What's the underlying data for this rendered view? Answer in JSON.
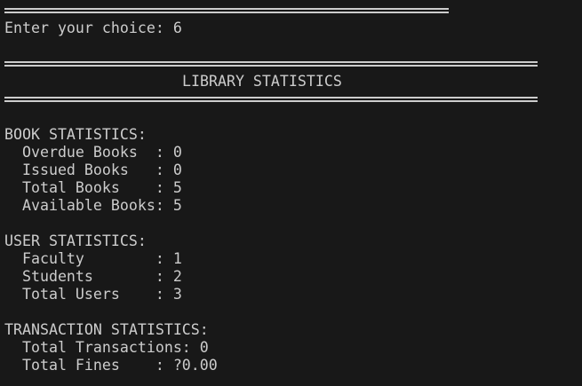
{
  "terminal": {
    "separator_text": "==================================================",
    "prompt": "Enter your choice: 6",
    "banner_separator_text": "============================================================",
    "title": "LIBRARY STATISTICS",
    "sections": {
      "books": {
        "header": "BOOK STATISTICS:",
        "lines": [
          "  Overdue Books  : 0",
          "  Issued Books   : 0",
          "  Total Books    : 5",
          "  Available Books: 5"
        ]
      },
      "users": {
        "header": "USER STATISTICS:",
        "lines": [
          "  Faculty        : 1",
          "  Students       : 2",
          "  Total Users    : 3"
        ]
      },
      "transactions": {
        "header": "TRANSACTION STATISTICS:",
        "lines": [
          "  Total Transactions: 0",
          "  Total Fines    : ?0.00"
        ]
      }
    },
    "colors": {
      "background": "#181818",
      "text": "#cccccc"
    }
  }
}
